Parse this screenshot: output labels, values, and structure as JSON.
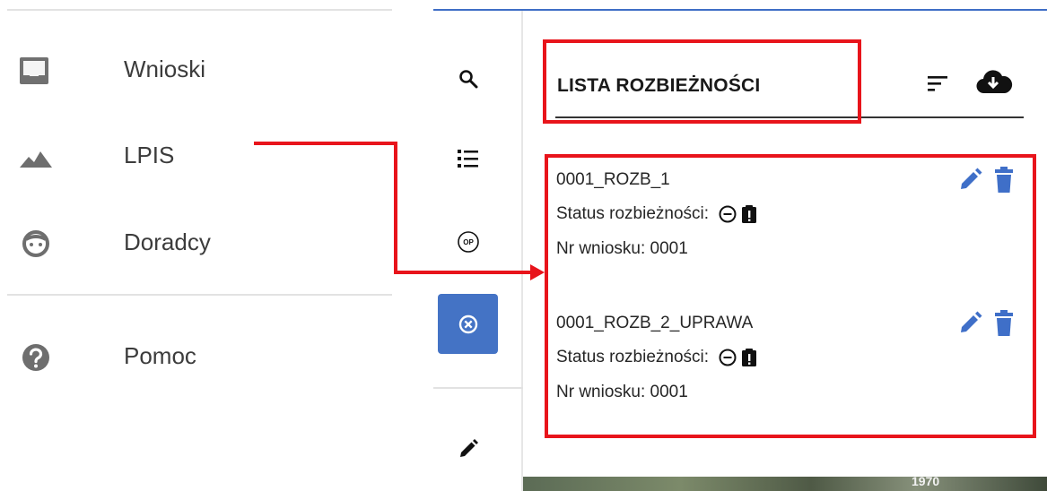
{
  "nav": {
    "items": [
      {
        "label": "Wnioski",
        "icon": "inbox-icon"
      },
      {
        "label": "LPIS",
        "icon": "landscape-icon"
      },
      {
        "label": "Doradcy",
        "icon": "face-icon"
      },
      {
        "label": "Pomoc",
        "icon": "help-icon"
      }
    ]
  },
  "toolbar": {
    "tools": [
      {
        "icon": "search-icon"
      },
      {
        "icon": "list-icon"
      },
      {
        "icon": "op-icon",
        "text": "OP"
      },
      {
        "icon": "close-circle-icon",
        "active": true
      },
      {
        "icon": "pencil-icon"
      }
    ]
  },
  "panel": {
    "title": "LISTA ROZBIEŻNOŚCI",
    "items": [
      {
        "id": "0001_ROZB_1",
        "status_label": "Status rozbieżności:",
        "nr": "Nr wniosku: 0001"
      },
      {
        "id": "0001_ROZB_2_UPRAWA",
        "status_label": "Status rozbieżności:",
        "nr": "Nr wniosku: 0001"
      }
    ]
  },
  "map": {
    "label": "1970"
  },
  "colors": {
    "accent": "#4473c5",
    "highlight": "#e8141b",
    "icon_blue": "#3f6fc8"
  }
}
